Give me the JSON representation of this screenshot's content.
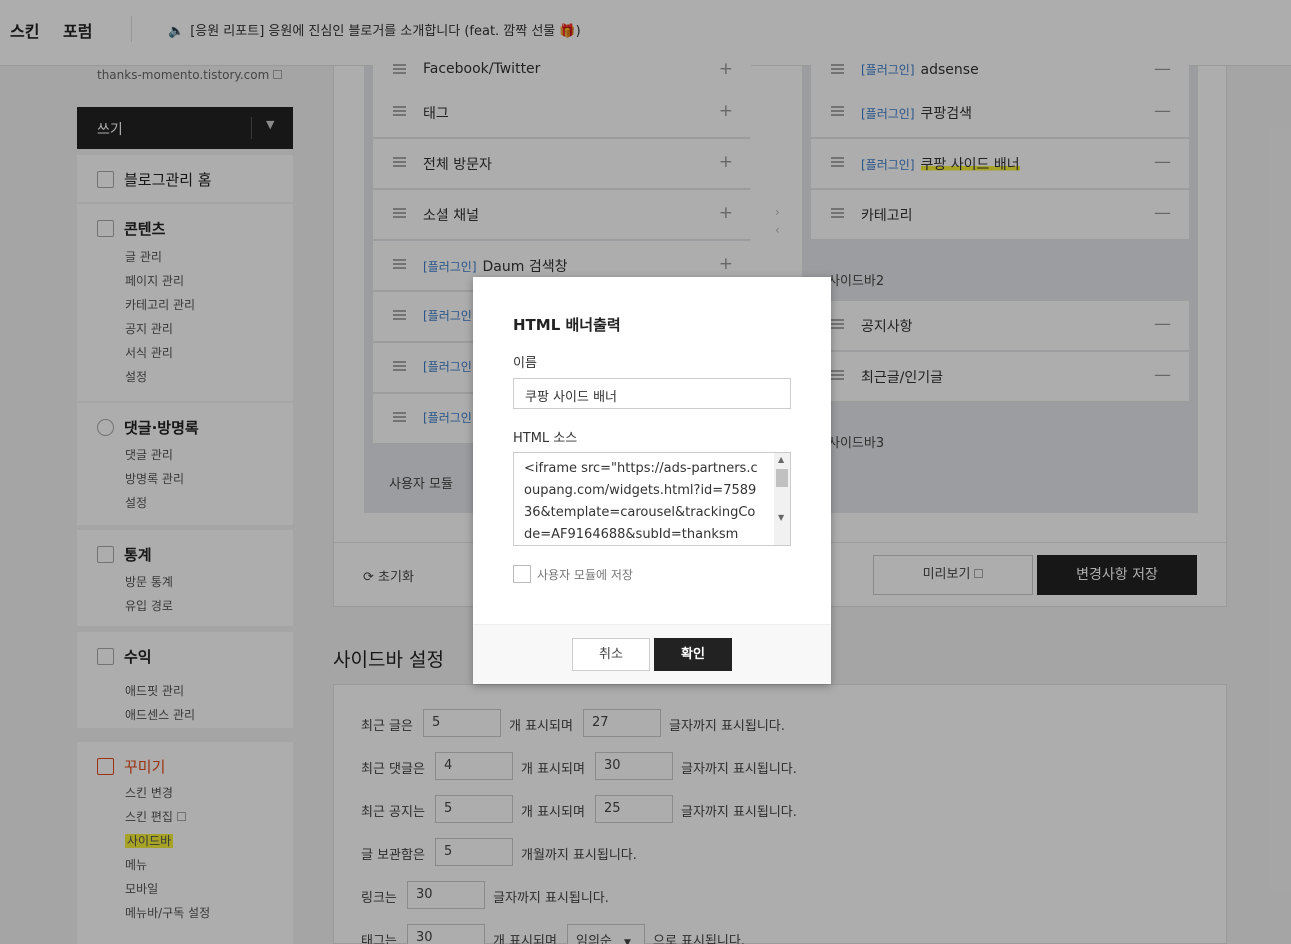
{
  "topbar": {
    "skin": "스킨",
    "forum": "포럼",
    "notice": "[응원 리포트] 응원에 진심인 블로거를 소개합니다 (feat. 깜짝 선물 🎁)"
  },
  "leftnav": {
    "blog_url": "thanks-momento.tistory.com",
    "write": "쓰기",
    "home": "블로그관리 홈",
    "contents": {
      "title": "콘텐츠",
      "items": [
        "글 관리",
        "페이지 관리",
        "카테고리 관리",
        "공지 관리",
        "서식 관리",
        "설정"
      ]
    },
    "comments": {
      "title": "댓글·방명록",
      "items": [
        "댓글 관리",
        "방명록 관리",
        "설정"
      ]
    },
    "stats": {
      "title": "통계",
      "items": [
        "방문 통계",
        "유입 경로"
      ]
    },
    "revenue": {
      "title": "수익",
      "items": [
        "애드핏 관리",
        "애드센스 관리"
      ]
    },
    "decorate": {
      "title": "꾸미기",
      "items": [
        "스킨 변경",
        "스킨 편집",
        "사이드바",
        "메뉴",
        "모바일",
        "메뉴바/구독 설정"
      ]
    }
  },
  "left_modules": {
    "rows": [
      {
        "tag": "",
        "name": "Facebook/Twitter"
      },
      {
        "tag": "",
        "name": "태그"
      },
      {
        "tag": "",
        "name": "전체 방문자"
      },
      {
        "tag": "",
        "name": "소셜 채널"
      },
      {
        "tag": "[플러그인]",
        "name": "Daum 검색창"
      },
      {
        "tag": "[플러그인]",
        "name": ""
      },
      {
        "tag": "[플러그인]",
        "name": ""
      },
      {
        "tag": "[플러그인]",
        "name": ""
      }
    ],
    "user_module": "사용자 모듈"
  },
  "right_modules": {
    "sidebar1_rows": [
      {
        "tag": "[플러그인]",
        "name": "adsense"
      },
      {
        "tag": "[플러그인]",
        "name": "쿠팡검색"
      },
      {
        "tag": "[플러그인]",
        "name": "쿠팡 사이드 배너"
      },
      {
        "tag": "",
        "name": "카테고리"
      }
    ],
    "sidebar2_label": "사이드바2",
    "sidebar2_rows": [
      {
        "tag": "",
        "name": "공지사항"
      },
      {
        "tag": "",
        "name": "최근글/인기글"
      }
    ],
    "sidebar3_label": "사이드바3"
  },
  "actions": {
    "reset": "초기화",
    "preview": "미리보기",
    "save": "변경사항 저장"
  },
  "sidebar_settings": {
    "title": "사이드바 설정",
    "rows": [
      {
        "label": "최근 글은",
        "v1": "5",
        "mid": "개 표시되며",
        "v2": "27",
        "end": "글자까지 표시됩니다."
      },
      {
        "label": "최근 댓글은",
        "v1": "4",
        "mid": "개 표시되며",
        "v2": "30",
        "end": "글자까지 표시됩니다."
      },
      {
        "label": "최근 공지는",
        "v1": "5",
        "mid": "개 표시되며",
        "v2": "25",
        "end": "글자까지 표시됩니다."
      },
      {
        "label": "글 보관함은",
        "v1": "5",
        "mid": "개월까지 표시됩니다."
      },
      {
        "label": "링크는",
        "v1": "30",
        "mid": "글자까지 표시됩니다."
      },
      {
        "label": "태그는",
        "v1": "30",
        "mid": "개 표시되며",
        "sel": "임의순",
        "end": "으로 표시됩니다."
      }
    ]
  },
  "modal": {
    "title": "HTML 배너출력",
    "name_label": "이름",
    "name_value": "쿠팡 사이드 배너",
    "src_label": "HTML 소스",
    "src_value": "<iframe src=\"https://ads-partners.coupang.com/widgets.html?id=758936&template=carousel&trackingCode=AF9164688&subId=thanksm",
    "save_module": "사용자 모듈에 저장",
    "cancel": "취소",
    "ok": "확인"
  }
}
